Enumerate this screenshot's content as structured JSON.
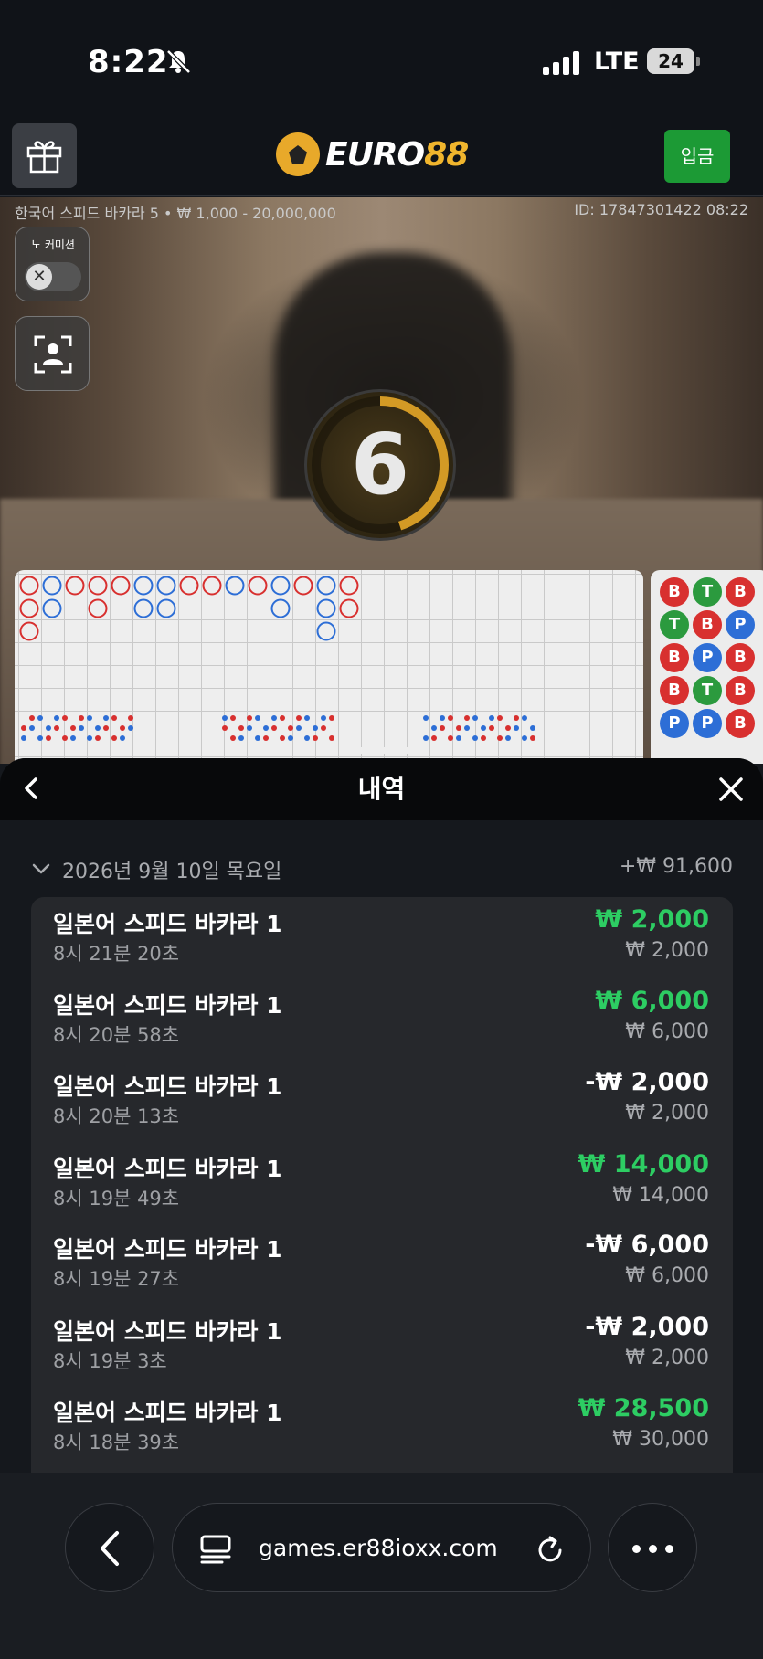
{
  "status_bar": {
    "time": "8:22",
    "network": "LTE",
    "battery": "24"
  },
  "header": {
    "logo_white": "EURO",
    "logo_gold": "88",
    "deposit_label": "입금"
  },
  "video": {
    "game_info": "한국어 스피드 바카라 5 • ₩ 1,000 - 20,000,000",
    "round_id": "ID: 17847301422 08:22",
    "no_commission_label": "노 커미션",
    "timer_value": "6",
    "timer_fraction": 0.45
  },
  "bead_road": [
    [
      "B",
      "T",
      "B"
    ],
    [
      "T",
      "B",
      "P"
    ],
    [
      "B",
      "P",
      "B"
    ],
    [
      "B",
      "T",
      "B"
    ],
    [
      "P",
      "P",
      "B"
    ]
  ],
  "history": {
    "title": "내역",
    "date": "2026년 9월 10일 목요일",
    "day_total": "+₩ 91,600",
    "rows": [
      {
        "name": "일본어 스피드 바카라 1",
        "time": "8시 21분 20초",
        "result": "₩ 2,000",
        "outcome": "win",
        "bet": "₩ 2,000"
      },
      {
        "name": "일본어 스피드 바카라 1",
        "time": "8시 20분 58초",
        "result": "₩ 6,000",
        "outcome": "win",
        "bet": "₩ 6,000"
      },
      {
        "name": "일본어 스피드 바카라 1",
        "time": "8시 20분 13초",
        "result": "-₩ 2,000",
        "outcome": "loss",
        "bet": "₩ 2,000"
      },
      {
        "name": "일본어 스피드 바카라 1",
        "time": "8시 19분 49초",
        "result": "₩ 14,000",
        "outcome": "win",
        "bet": "₩ 14,000"
      },
      {
        "name": "일본어 스피드 바카라 1",
        "time": "8시 19분 27초",
        "result": "-₩ 6,000",
        "outcome": "loss",
        "bet": "₩ 6,000"
      },
      {
        "name": "일본어 스피드 바카라 1",
        "time": "8시 19분 3초",
        "result": "-₩ 2,000",
        "outcome": "loss",
        "bet": "₩ 2,000"
      },
      {
        "name": "일본어 스피드 바카라 1",
        "time": "8시 18분 39초",
        "result": "₩ 28,500",
        "outcome": "win",
        "bet": "₩ 30,000"
      }
    ]
  },
  "browser": {
    "url": "games.er88ioxx.com"
  },
  "colors": {
    "win": "#2dcd63",
    "deposit": "#1c9a35",
    "gold": "#f0b52d",
    "banker": "#d8302f",
    "player": "#2d6ed6",
    "tie": "#2b9a3e"
  }
}
